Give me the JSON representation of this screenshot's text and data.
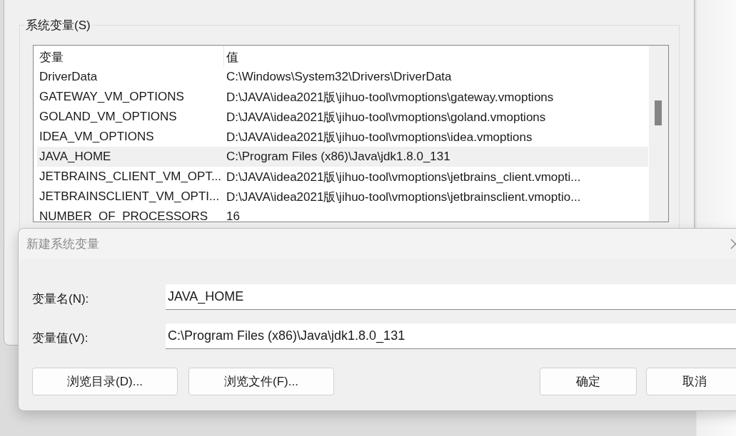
{
  "system_variables": {
    "title": "系统变量(S)",
    "columns": [
      "变量",
      "值"
    ],
    "rows": [
      {
        "name": "DriverData",
        "value": "C:\\Windows\\System32\\Drivers\\DriverData",
        "selected": false
      },
      {
        "name": "GATEWAY_VM_OPTIONS",
        "value": "D:\\JAVA\\idea2021版\\jihuo-tool\\vmoptions\\gateway.vmoptions",
        "selected": false
      },
      {
        "name": "GOLAND_VM_OPTIONS",
        "value": "D:\\JAVA\\idea2021版\\jihuo-tool\\vmoptions\\goland.vmoptions",
        "selected": false
      },
      {
        "name": "IDEA_VM_OPTIONS",
        "value": "D:\\JAVA\\idea2021版\\jihuo-tool\\vmoptions\\idea.vmoptions",
        "selected": false
      },
      {
        "name": "JAVA_HOME",
        "value": "C:\\Program Files (x86)\\Java\\jdk1.8.0_131",
        "selected": true
      },
      {
        "name": "JETBRAINS_CLIENT_VM_OPT...",
        "value": "D:\\JAVA\\idea2021版\\jihuo-tool\\vmoptions\\jetbrains_client.vmopti...",
        "selected": false
      },
      {
        "name": "JETBRAINSCLIENT_VM_OPTI...",
        "value": "D:\\JAVA\\idea2021版\\jihuo-tool\\vmoptions\\jetbrainsclient.vmoptio...",
        "selected": false
      },
      {
        "name": "NUMBER_OF_PROCESSORS",
        "value": "16",
        "selected": false
      }
    ]
  },
  "dialog": {
    "title": "新建系统变量",
    "fields": [
      {
        "label": "变量名(N):",
        "value": "JAVA_HOME"
      },
      {
        "label": "变量值(V):",
        "value": "C:\\Program Files (x86)\\Java\\jdk1.8.0_131"
      }
    ],
    "browse_buttons": [
      "浏览目录(D)...",
      "浏览文件(F)..."
    ],
    "action_buttons": [
      "确定",
      "取消"
    ]
  }
}
